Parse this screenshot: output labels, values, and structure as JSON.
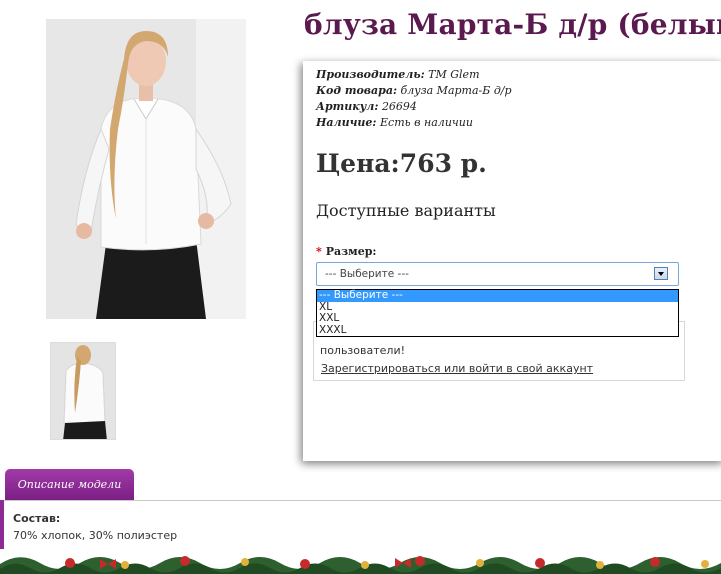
{
  "product": {
    "title": "блуза Марта-Б д/р (белый)"
  },
  "specs": [
    {
      "label": "Производитель:",
      "value": "ТМ Glem"
    },
    {
      "label": "Код товара:",
      "value": "блуза Марта-Б д/р"
    },
    {
      "label": "Артикул:",
      "value": "26694"
    },
    {
      "label": "Наличие:",
      "value": "Есть в наличии"
    }
  ],
  "price": {
    "label": "Цена:",
    "value": "763 р."
  },
  "variants": {
    "heading": "Доступные варианты",
    "size_label": "Размер:",
    "required_mark": "*",
    "select_value": "--- Выберите ---",
    "options": [
      "--- Выберите ---",
      "XL",
      "XXL",
      "XXXL"
    ],
    "selected_index": 0
  },
  "login": {
    "note": "пользователи!",
    "link": "Зарегистрироваться или войти в свой аккаунт"
  },
  "description": {
    "tab_label": "Описание модели",
    "composition_heading": "Состав:",
    "composition_value": "70% хлопок, 30% полиэстер"
  },
  "colors": {
    "title": "#5a1a4f",
    "tab": "#8d2b96",
    "dropdown_selected": "#3399ff"
  }
}
